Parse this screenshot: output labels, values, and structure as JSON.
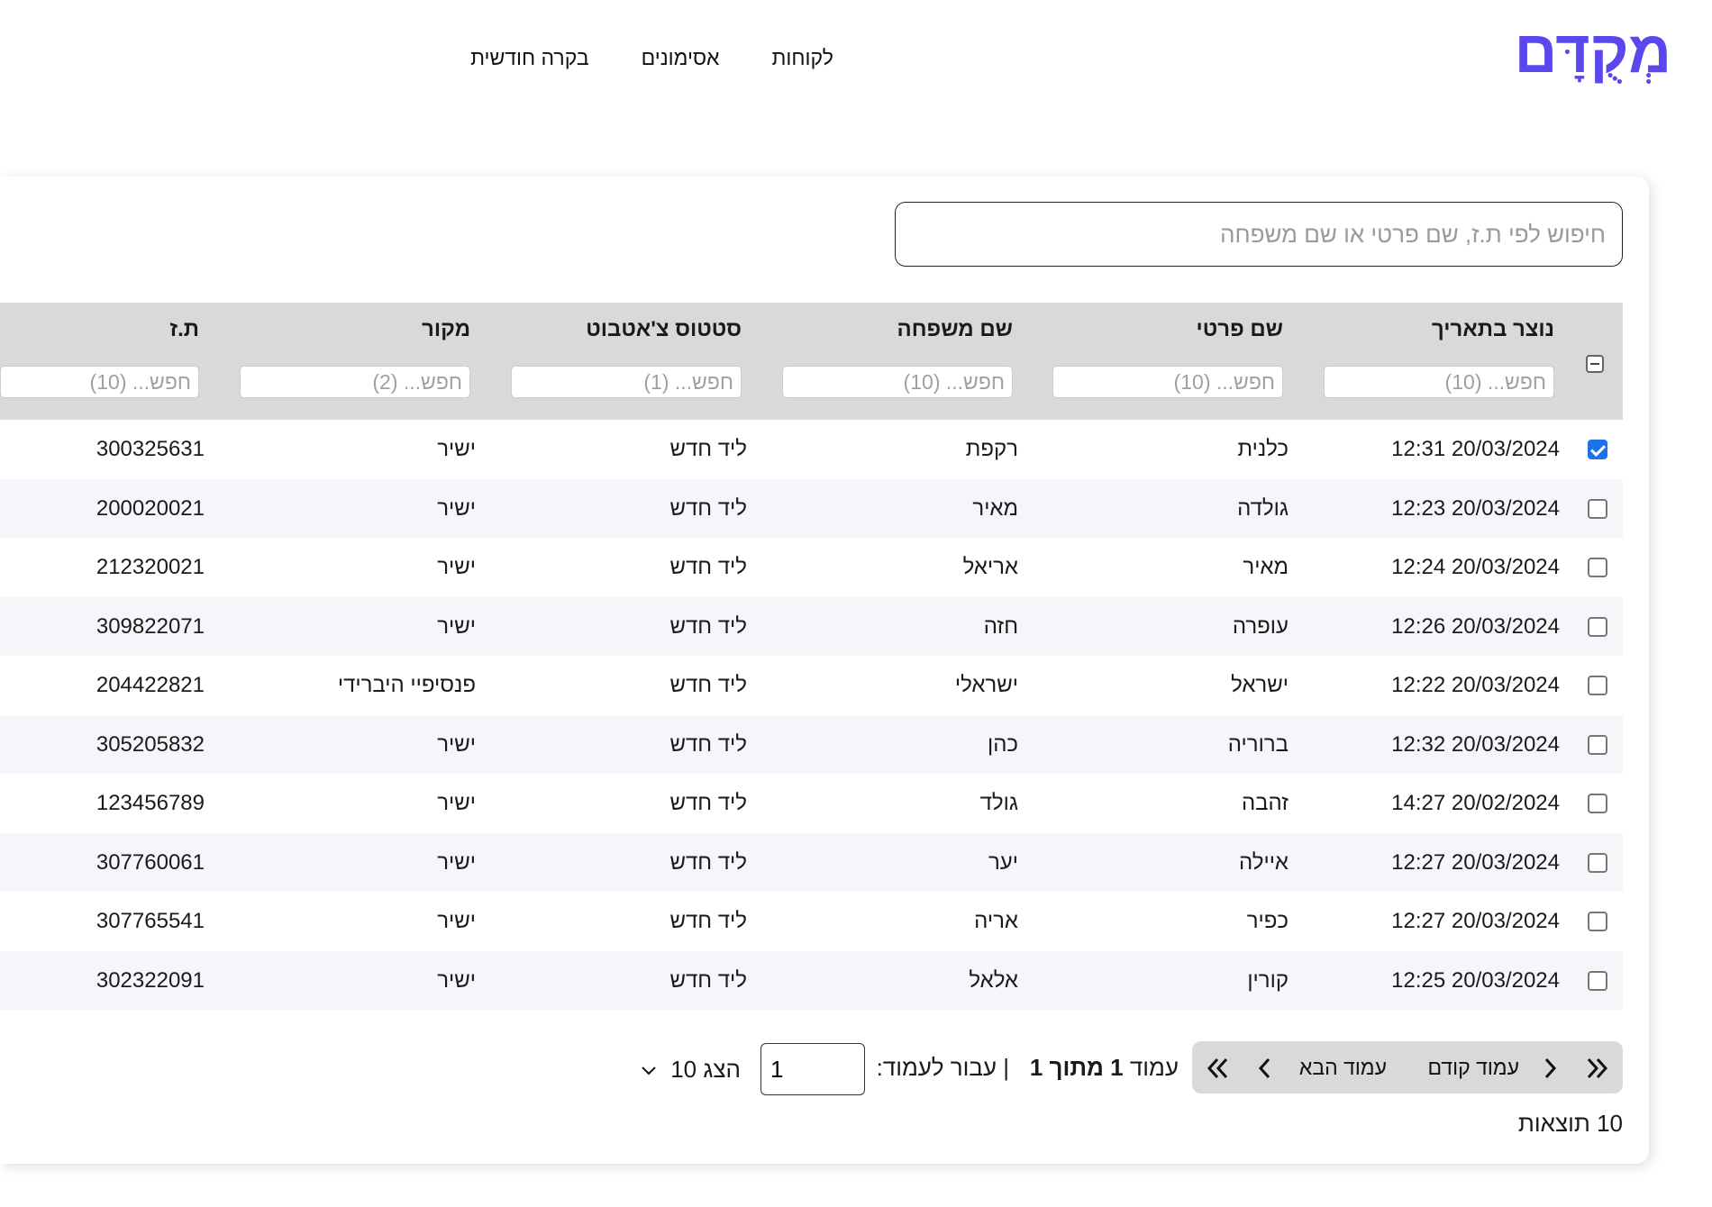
{
  "brand": {
    "logo_text": "מְקֻדָּם",
    "accent": "#5a48ee"
  },
  "nav": {
    "items": [
      "לקוחות",
      "אסימונים",
      "בקרה חודשית"
    ]
  },
  "search": {
    "placeholder": "חיפוש לפי ת.ז, שם פרטי או שם משפחה",
    "value": ""
  },
  "table": {
    "columns": [
      {
        "title": "נוצר בתאריך",
        "filter_placeholder": "חפש... (10)"
      },
      {
        "title": "שם פרטי",
        "filter_placeholder": "חפש... (10)"
      },
      {
        "title": "שם משפחה",
        "filter_placeholder": "חפש... (10)"
      },
      {
        "title": "סטטוס צ'אטבוט",
        "filter_placeholder": "חפש... (1)"
      },
      {
        "title": "מקור",
        "filter_placeholder": "חפש... (2)"
      },
      {
        "title": "ת.ז",
        "filter_placeholder": "חפש... (10)"
      }
    ],
    "rows": [
      {
        "checked": true,
        "cells": [
          "20/03/2024 12:31",
          "כלנית",
          "רקפת",
          "ליד חדש",
          "ישיר",
          "300325631"
        ]
      },
      {
        "checked": false,
        "cells": [
          "20/03/2024 12:23",
          "גולדה",
          "מאיר",
          "ליד חדש",
          "ישיר",
          "200020021"
        ]
      },
      {
        "checked": false,
        "cells": [
          "20/03/2024 12:24",
          "מאיר",
          "אריאל",
          "ליד חדש",
          "ישיר",
          "212320021"
        ]
      },
      {
        "checked": false,
        "cells": [
          "20/03/2024 12:26",
          "עופרה",
          "חזה",
          "ליד חדש",
          "ישיר",
          "309822071"
        ]
      },
      {
        "checked": false,
        "cells": [
          "20/03/2024 12:22",
          "ישראל",
          "ישראלי",
          "ליד חדש",
          "פנסיפיי היברידי",
          "204422821"
        ]
      },
      {
        "checked": false,
        "cells": [
          "20/03/2024 12:32",
          "ברוריה",
          "כהן",
          "ליד חדש",
          "ישיר",
          "305205832"
        ]
      },
      {
        "checked": false,
        "cells": [
          "20/02/2024 14:27",
          "זהבה",
          "גולד",
          "ליד חדש",
          "ישיר",
          "123456789"
        ]
      },
      {
        "checked": false,
        "cells": [
          "20/03/2024 12:27",
          "איילה",
          "יער",
          "ליד חדש",
          "ישיר",
          "307760061"
        ]
      },
      {
        "checked": false,
        "cells": [
          "20/03/2024 12:27",
          "כפיר",
          "אריה",
          "ליד חדש",
          "ישיר",
          "307765541"
        ]
      },
      {
        "checked": false,
        "cells": [
          "20/03/2024 12:25",
          "קורין",
          "אלאל",
          "ליד חדש",
          "ישיר",
          "302322091"
        ]
      }
    ]
  },
  "pagination": {
    "prev_label": "עמוד קודם",
    "next_label": "עמוד הבא",
    "page_word": "עמוד",
    "page_current": "1",
    "of_word": "מתוך",
    "page_total": "1",
    "goto_label": "| עבור לעמוד:",
    "goto_value": "1",
    "show_label": "הצג 10",
    "results_label": "10 תוצאות"
  },
  "icons": {
    "first_page": "double-chevron-right-icon",
    "prev_page": "chevron-right-icon",
    "next_page": "chevron-left-icon",
    "last_page": "double-chevron-left-icon",
    "dropdown": "chevron-down-icon"
  }
}
